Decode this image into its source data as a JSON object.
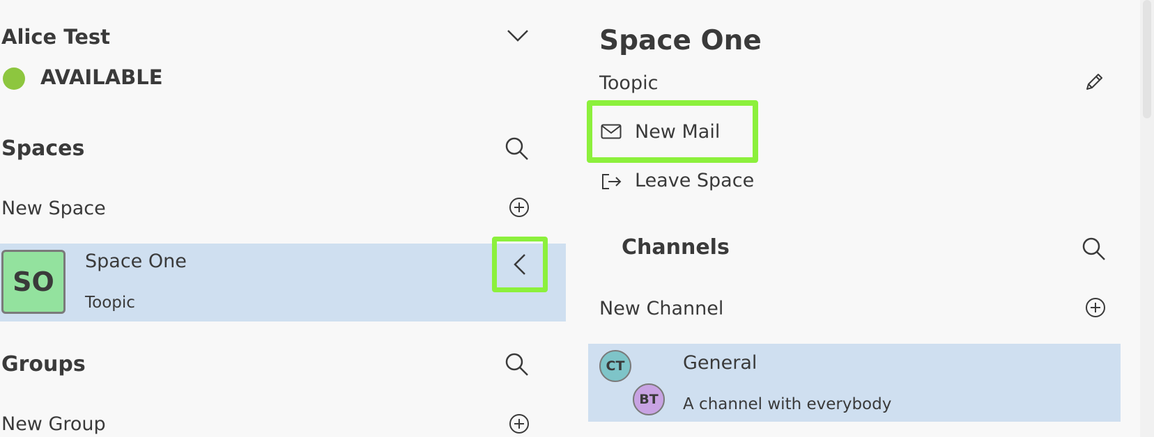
{
  "user": {
    "name": "Alice Test",
    "status": "AVAILABLE",
    "status_color": "#8dc63f"
  },
  "spaces": {
    "title": "Spaces",
    "new_label": "New Space",
    "items": [
      {
        "initials": "SO",
        "name": "Space One",
        "topic": "Toopic",
        "avatar_color": "#93e29e"
      }
    ]
  },
  "groups": {
    "title": "Groups",
    "new_label": "New Group"
  },
  "space_detail": {
    "title": "Space One",
    "topic": "Toopic",
    "actions": {
      "new_mail": "New Mail",
      "leave_space": "Leave Space"
    },
    "channels": {
      "title": "Channels",
      "new_label": "New Channel",
      "items": [
        {
          "name": "General",
          "description": "A channel with everybody",
          "members": [
            {
              "initials": "CT",
              "color": "#7ec4c8"
            },
            {
              "initials": "BT",
              "color": "#c8a3e3"
            }
          ]
        }
      ]
    }
  },
  "colors": {
    "highlight": "#8cf03c",
    "selected_row": "#cfdff0",
    "background": "#f8f8f8"
  }
}
